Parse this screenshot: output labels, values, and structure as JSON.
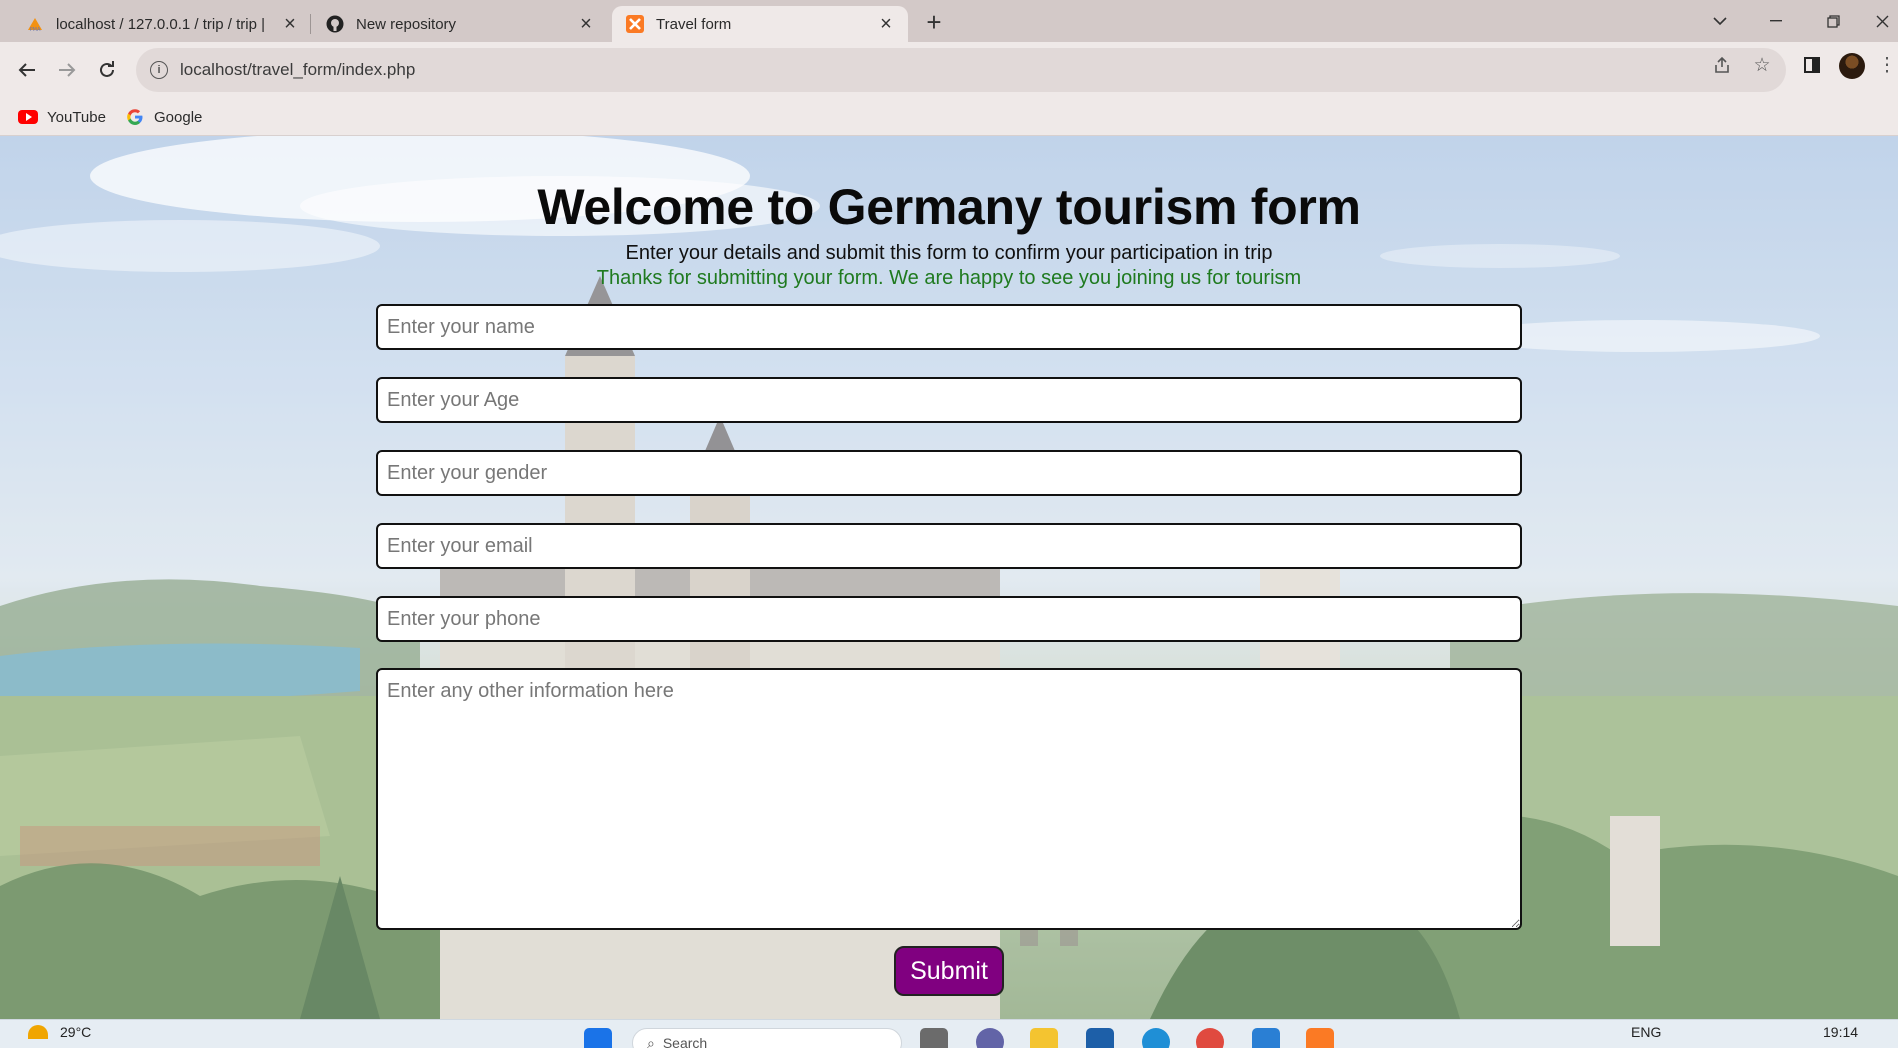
{
  "tabs": [
    {
      "title": "localhost / 127.0.0.1 / trip / trip |",
      "favicon": "phpmyadmin-icon"
    },
    {
      "title": "New repository",
      "favicon": "github-icon"
    },
    {
      "title": "Travel form",
      "favicon": "xampp-icon"
    }
  ],
  "address_bar": {
    "url": "localhost/travel_form/index.php"
  },
  "bookmarks": [
    {
      "label": "YouTube",
      "icon": "youtube-icon"
    },
    {
      "label": "Google",
      "icon": "google-icon"
    }
  ],
  "page": {
    "title": "Welcome to Germany tourism form",
    "subtitle": "Enter your details and submit this form to confirm your participation in trip",
    "success_message": "Thanks for submitting your form. We are happy to see you joining us for tourism",
    "fields": {
      "name_placeholder": "Enter your name",
      "age_placeholder": "Enter your Age",
      "gender_placeholder": "Enter your gender",
      "email_placeholder": "Enter your email",
      "phone_placeholder": "Enter your phone",
      "info_placeholder": "Enter any other information here"
    },
    "submit_label": "Submit"
  },
  "taskbar": {
    "temperature": "29°C",
    "search_placeholder": "Search",
    "language": "ENG",
    "time": "19:14"
  },
  "colors": {
    "submit_button": "#800080",
    "success_text": "#1f7a1f",
    "tab_strip": "#d3c9c8"
  }
}
